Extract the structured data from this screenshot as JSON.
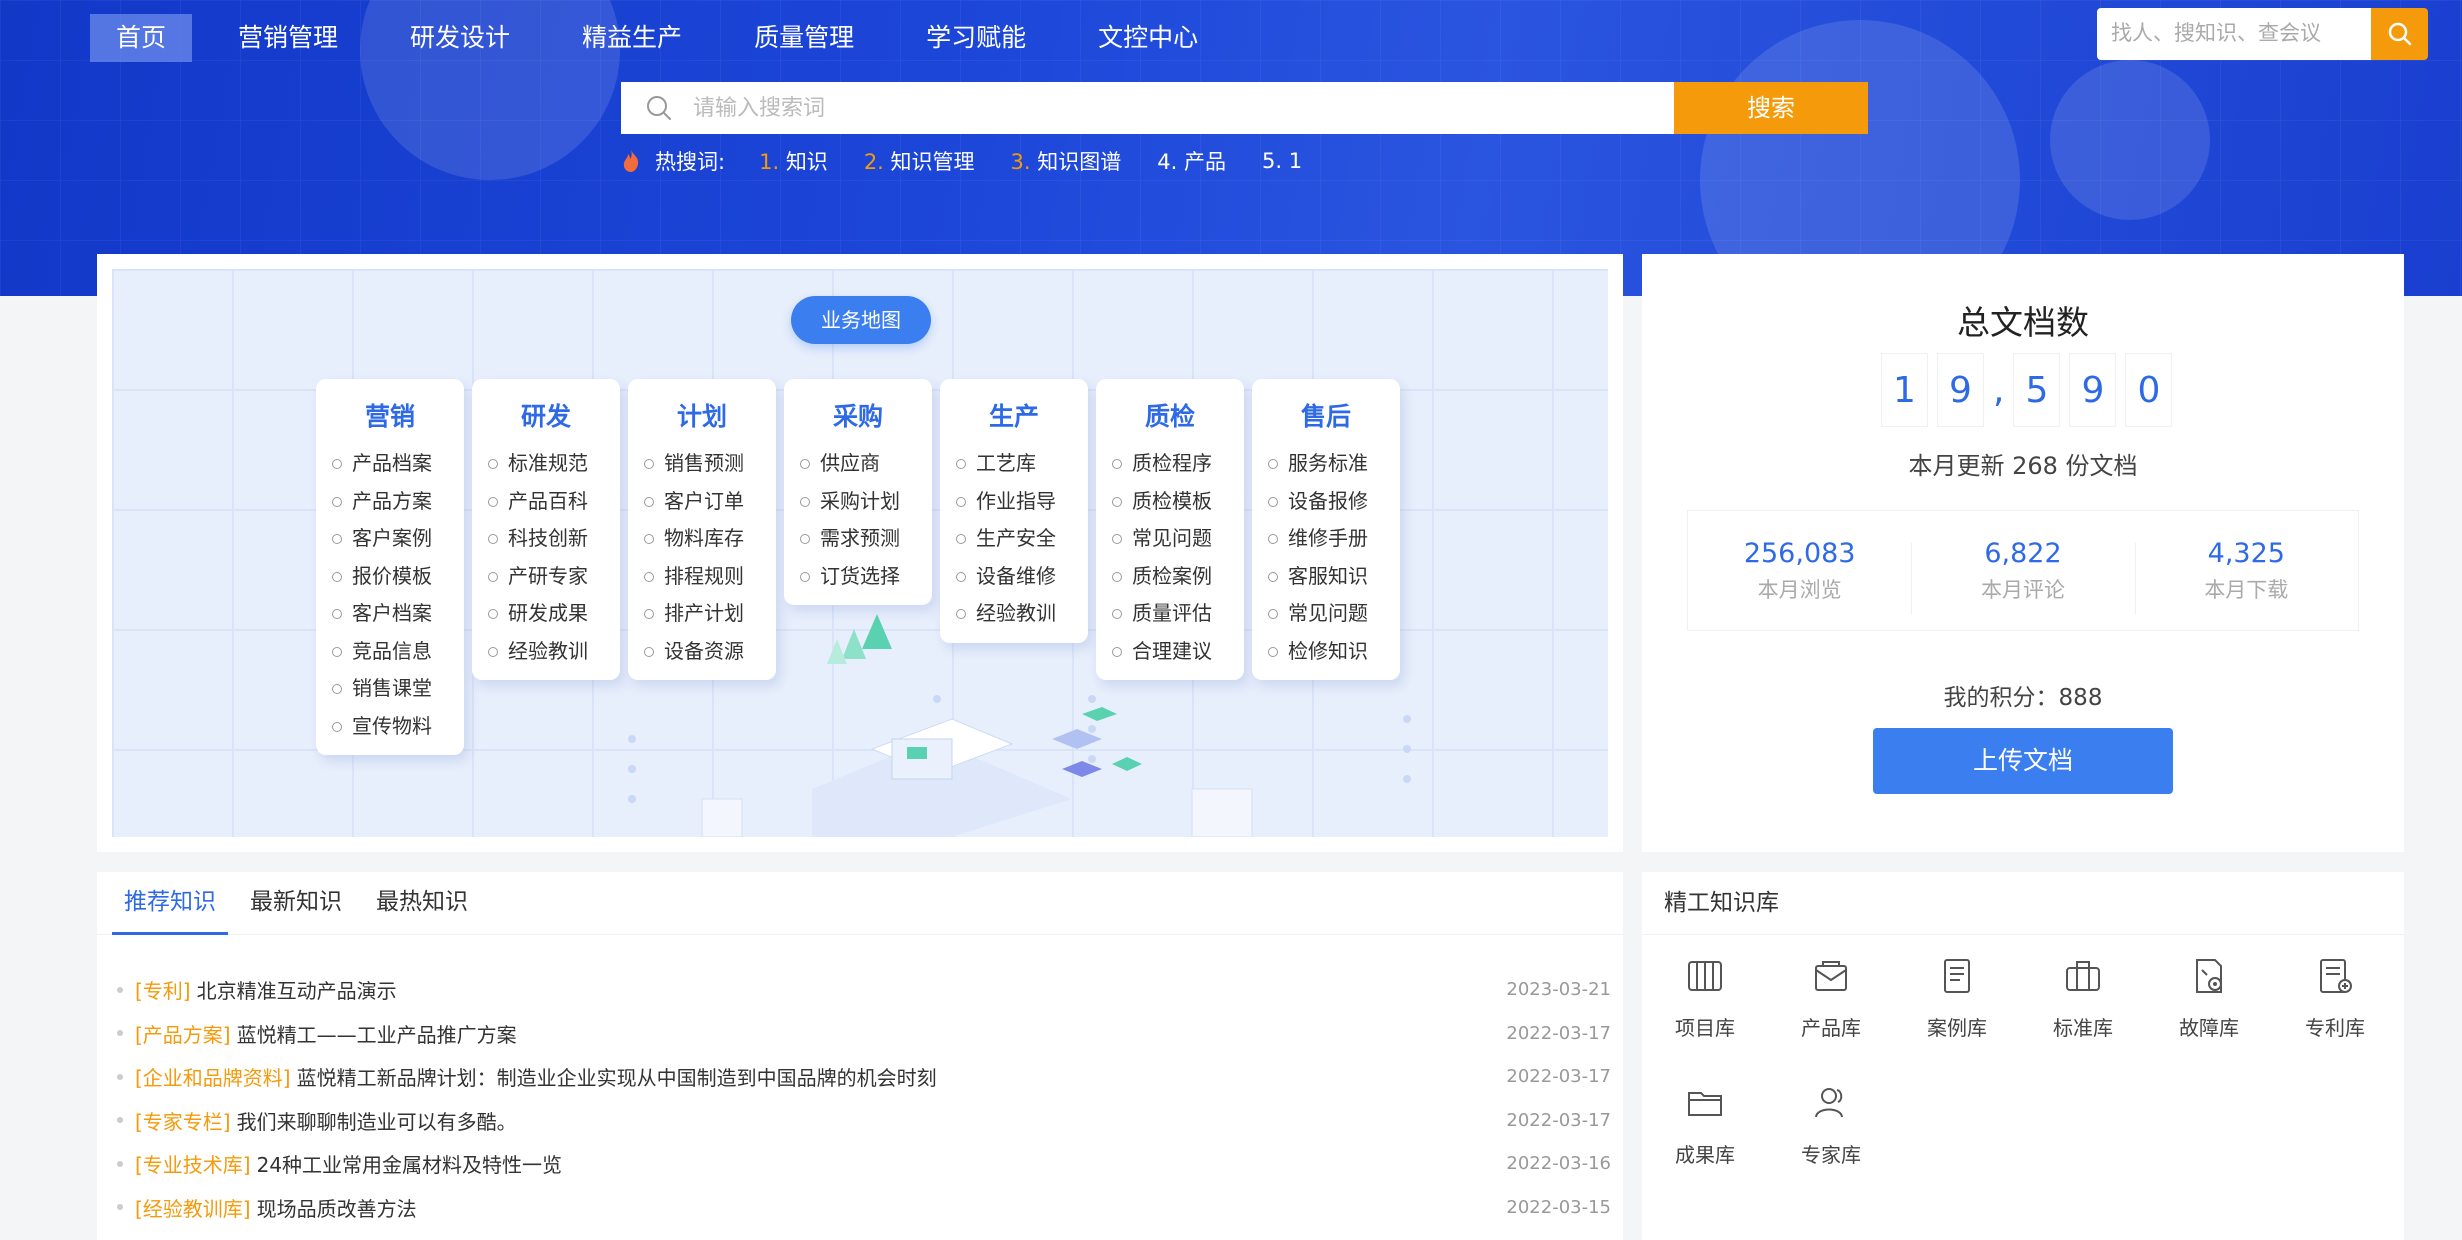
{
  "nav": {
    "items": [
      "首页",
      "营销管理",
      "研发设计",
      "精益生产",
      "质量管理",
      "学习赋能",
      "文控中心"
    ],
    "active": "首页",
    "search_placeholder": "找人、搜知识、查会议"
  },
  "search": {
    "placeholder": "请输入搜索词",
    "button": "搜索",
    "hot_label": "热搜词:",
    "hot": [
      {
        "num": "1.",
        "text": "知识"
      },
      {
        "num": "2.",
        "text": "知识管理"
      },
      {
        "num": "3.",
        "text": "知识图谱"
      },
      {
        "num": "4.",
        "text": "产品"
      },
      {
        "num": "5.",
        "text": "1"
      }
    ]
  },
  "biz_map": {
    "tag": "业务地图",
    "columns": [
      {
        "title": "营销",
        "items": [
          "产品档案",
          "产品方案",
          "客户案例",
          "报价模板",
          "客户档案",
          "竞品信息",
          "销售课堂",
          "宣传物料"
        ]
      },
      {
        "title": "研发",
        "items": [
          "标准规范",
          "产品百科",
          "科技创新",
          "产研专家",
          "研发成果",
          "经验教训"
        ]
      },
      {
        "title": "计划",
        "items": [
          "销售预测",
          "客户订单",
          "物料库存",
          "排程规则",
          "排产计划",
          "设备资源"
        ]
      },
      {
        "title": "采购",
        "items": [
          "供应商",
          "采购计划",
          "需求预测",
          "订货选择"
        ]
      },
      {
        "title": "生产",
        "items": [
          "工艺库",
          "作业指导",
          "生产安全",
          "设备维修",
          "经验教训"
        ]
      },
      {
        "title": "质检",
        "items": [
          "质检程序",
          "质检模板",
          "常见问题",
          "质检案例",
          "质量评估",
          "合理建议"
        ]
      },
      {
        "title": "售后",
        "items": [
          "服务标准",
          "设备报修",
          "维修手册",
          "客服知识",
          "常见问题",
          "检修知识"
        ]
      }
    ]
  },
  "stats": {
    "title": "总文档数",
    "digits": [
      "1",
      "9",
      ",",
      "5",
      "9",
      "0"
    ],
    "monthly_update": "本月更新 268 份文档",
    "items": [
      {
        "value": "256,083",
        "label": "本月浏览"
      },
      {
        "value": "6,822",
        "label": "本月评论"
      },
      {
        "value": "4,325",
        "label": "本月下载"
      }
    ],
    "points": "我的积分：888",
    "upload": "上传文档"
  },
  "knowledge": {
    "tabs": [
      "推荐知识",
      "最新知识",
      "最热知识"
    ],
    "active_tab": "推荐知识",
    "rows": [
      {
        "cat": "[专利]",
        "title": "北京精准互动产品演示",
        "date": "2023-03-21"
      },
      {
        "cat": "[产品方案]",
        "title": "蓝悦精工——工业产品推广方案",
        "date": "2022-03-17"
      },
      {
        "cat": "[企业和品牌资料]",
        "title": "蓝悦精工新品牌计划：制造业企业实现从中国制造到中国品牌的机会时刻",
        "date": "2022-03-17"
      },
      {
        "cat": "[专家专栏]",
        "title": "我们来聊聊制造业可以有多酷。",
        "date": "2022-03-17"
      },
      {
        "cat": "[专业技术库]",
        "title": "24种工业常用金属材料及特性一览",
        "date": "2022-03-16"
      },
      {
        "cat": "[经验教训库]",
        "title": "现场品质改善方法",
        "date": "2022-03-15"
      }
    ]
  },
  "library": {
    "title": "精工知识库",
    "items": [
      {
        "name": "项目库",
        "icon": "project-icon"
      },
      {
        "name": "产品库",
        "icon": "product-icon"
      },
      {
        "name": "案例库",
        "icon": "case-icon"
      },
      {
        "name": "标准库",
        "icon": "standard-icon"
      },
      {
        "name": "故障库",
        "icon": "fault-icon"
      },
      {
        "name": "专利库",
        "icon": "patent-icon"
      },
      {
        "name": "成果库",
        "icon": "folder-icon"
      },
      {
        "name": "专家库",
        "icon": "expert-icon"
      }
    ]
  },
  "colors": {
    "primary": "#2f6ae6",
    "accent": "#f59a0b",
    "banner": "#1a3fd0"
  }
}
